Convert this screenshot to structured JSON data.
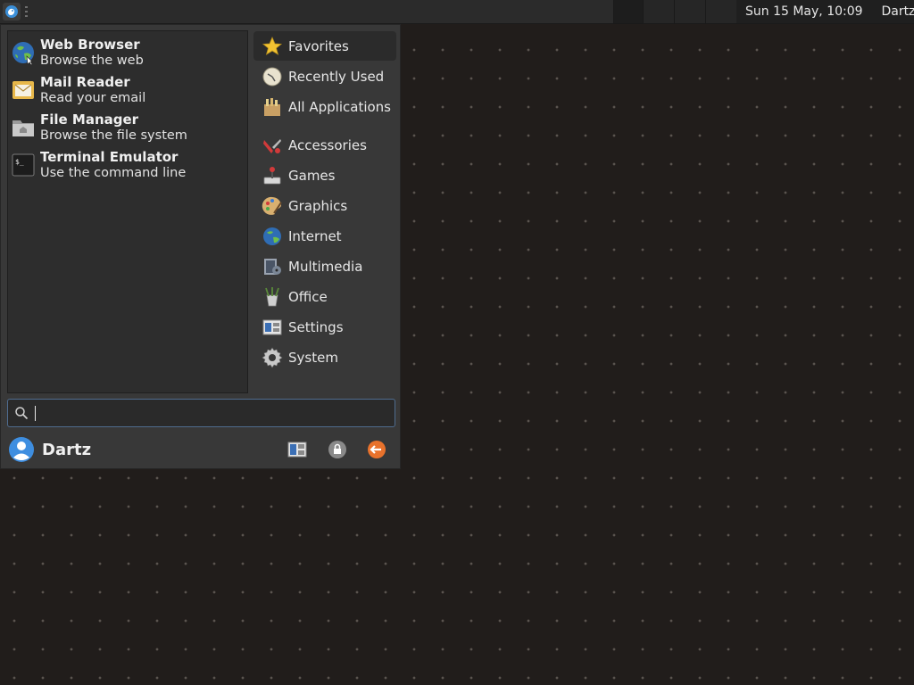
{
  "panel": {
    "clock": "Sun 15 May, 10:09",
    "user": "Dartz"
  },
  "favorites": [
    {
      "name": "Web Browser",
      "desc": "Browse the web",
      "icon": "globe-icon"
    },
    {
      "name": "Mail Reader",
      "desc": "Read your email",
      "icon": "mail-icon"
    },
    {
      "name": "File Manager",
      "desc": "Browse the file system",
      "icon": "folder-icon"
    },
    {
      "name": "Terminal Emulator",
      "desc": "Use the command line",
      "icon": "terminal-icon"
    }
  ],
  "categories": [
    {
      "label": "Favorites",
      "icon": "star-icon",
      "selected": true
    },
    {
      "label": "Recently Used",
      "icon": "clock-icon"
    },
    {
      "label": "All Applications",
      "icon": "applications-icon"
    },
    {
      "label": "Accessories",
      "icon": "accessories-icon"
    },
    {
      "label": "Games",
      "icon": "joystick-icon"
    },
    {
      "label": "Graphics",
      "icon": "palette-icon"
    },
    {
      "label": "Internet",
      "icon": "globe-icon"
    },
    {
      "label": "Multimedia",
      "icon": "multimedia-icon"
    },
    {
      "label": "Office",
      "icon": "office-icon"
    },
    {
      "label": "Settings",
      "icon": "settings-icon"
    },
    {
      "label": "System",
      "icon": "gear-icon"
    }
  ],
  "search": {
    "value": "",
    "placeholder": ""
  },
  "user": {
    "name": "Dartz"
  },
  "colors": {
    "accent": "#4f6c8f",
    "logout": "#e8722c",
    "background": "#211d1b"
  }
}
